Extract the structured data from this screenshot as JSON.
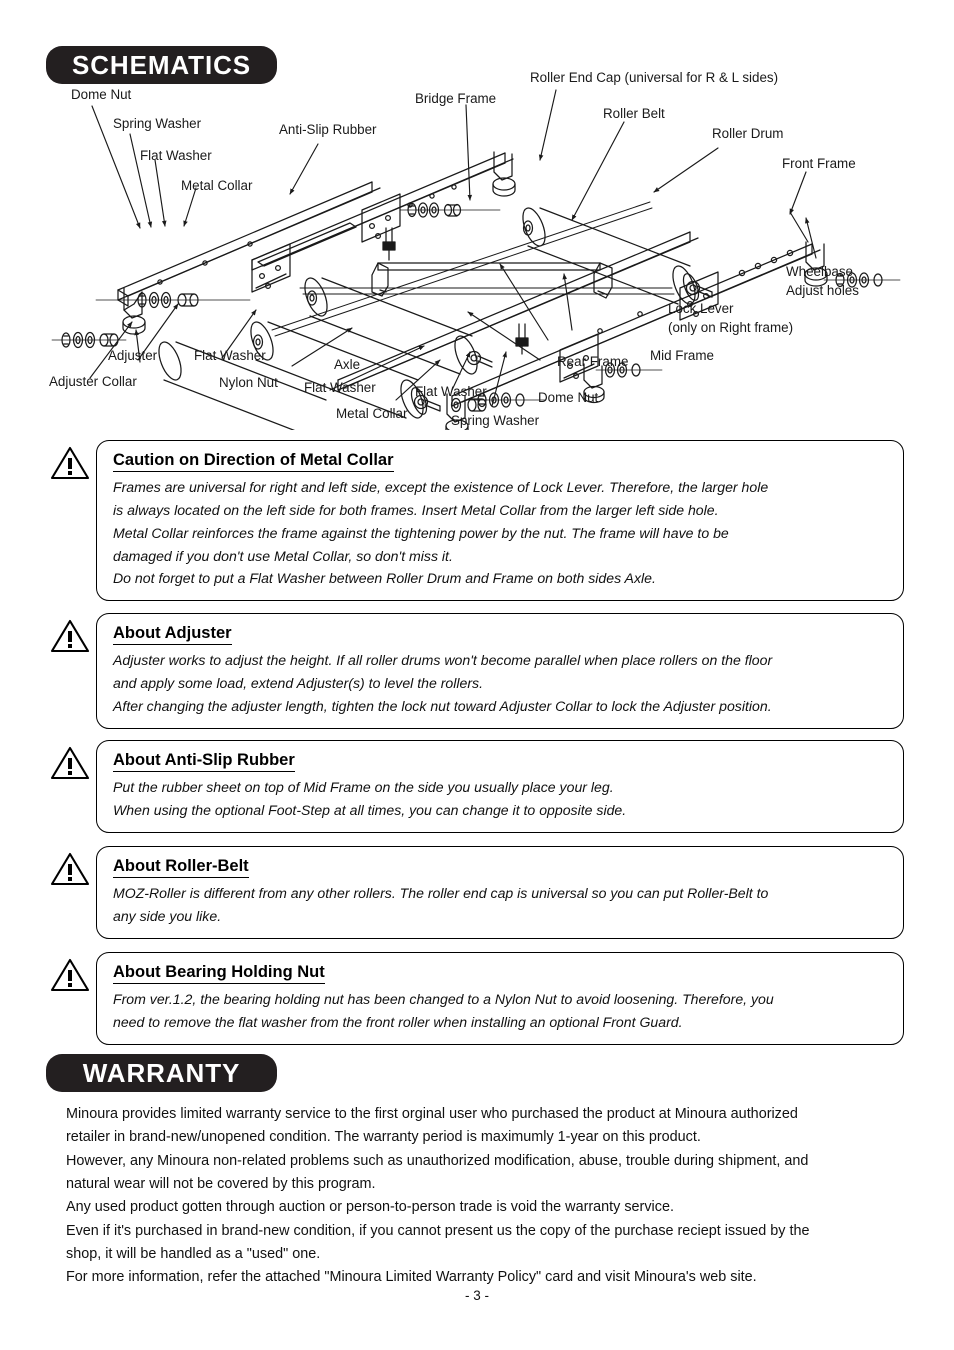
{
  "sections": {
    "schematics": {
      "badge_label": "SCHEMATICS"
    },
    "warranty": {
      "badge_label": "WARRANTY"
    }
  },
  "schematic": {
    "labels": [
      {
        "id": "dome-nut-left",
        "text": "Dome Nut"
      },
      {
        "id": "spring-washer-left",
        "text": "Spring Washer"
      },
      {
        "id": "flat-washer-upper-left",
        "text": "Flat Washer"
      },
      {
        "id": "metal-collar-upper-left",
        "text": "Metal Collar"
      },
      {
        "id": "anti-slip-rubber",
        "text": "Anti-Slip Rubber"
      },
      {
        "id": "bridge-frame",
        "text": "Bridge Frame"
      },
      {
        "id": "roller-end-cap",
        "text": "Roller End Cap (universal for R & L sides)"
      },
      {
        "id": "roller-belt",
        "text": "Roller Belt"
      },
      {
        "id": "roller-drum",
        "text": "Roller Drum"
      },
      {
        "id": "front-frame",
        "text": "Front Frame"
      },
      {
        "id": "wheelbase-line1",
        "text": "Wheelbase"
      },
      {
        "id": "wheelbase-line2",
        "text": "Adjust holes"
      },
      {
        "id": "lock-lever-line1",
        "text": "Lock Lever"
      },
      {
        "id": "lock-lever-line2",
        "text": "(only on Right frame)"
      },
      {
        "id": "mid-frame",
        "text": "Mid Frame"
      },
      {
        "id": "rear-frame",
        "text": "Rear Frame"
      },
      {
        "id": "dome-nut-right",
        "text": "Dome Nut"
      },
      {
        "id": "spring-washer-right",
        "text": "Spring Washer"
      },
      {
        "id": "flat-washer-right",
        "text": "Flat Washer"
      },
      {
        "id": "metal-collar-lower",
        "text": "Metal Collar"
      },
      {
        "id": "flat-washer-lower-mid",
        "text": "Flat Washer"
      },
      {
        "id": "axle",
        "text": "Axle"
      },
      {
        "id": "nylon-nut",
        "text": "Nylon Nut"
      },
      {
        "id": "flat-washer-lower-left",
        "text": "Flat Washer"
      },
      {
        "id": "adjuster",
        "text": "Adjuster"
      },
      {
        "id": "adjuster-collar",
        "text": "Adjuster Collar"
      }
    ]
  },
  "cautions": [
    {
      "id": "metal-collar",
      "title": "Caution on Direction of Metal Collar",
      "lines": [
        "Frames are universal for right and left side, except the existence of Lock Lever. Therefore, the larger hole",
        "is always located on the left side for both frames. Insert Metal Collar from the larger left side hole.",
        "Metal Collar reinforces the frame against the tightening power by the nut. The frame will have to be",
        "damaged if you don't use Metal Collar, so don't miss it.",
        "Do not forget to put a Flat Washer between Roller Drum and Frame on both sides Axle."
      ]
    },
    {
      "id": "adjuster",
      "title": "About Adjuster",
      "lines": [
        "Adjuster works to adjust the height. If all roller drums won't become parallel when place rollers on the floor",
        "and apply some load, extend Adjuster(s) to level the rollers.",
        "After changing the adjuster length, tighten the lock nut toward Adjuster Collar to lock the Adjuster position."
      ]
    },
    {
      "id": "anti-slip-rubber",
      "title": "About Anti-Slip Rubber",
      "lines": [
        "Put the rubber sheet on top of Mid Frame on the side you usually place your leg.",
        "When using the optional Foot-Step at all times, you can change it to opposite side."
      ]
    },
    {
      "id": "roller-belt",
      "title": "About Roller-Belt",
      "lines": [
        "MOZ-Roller is different from any other rollers. The roller end cap is universal so you can put Roller-Belt to",
        "any side you like."
      ]
    },
    {
      "id": "bearing-holding-nut",
      "title": "About Bearing Holding Nut",
      "lines": [
        "From ver.1.2, the bearing holding nut has been changed to a Nylon Nut to avoid loosening. Therefore, you",
        "need to remove the flat washer from the front roller when installing an optional Front Guard."
      ]
    }
  ],
  "warranty": {
    "lines": [
      "Minoura provides limited warranty service to the first orginal user who purchased the product at Minoura authorized",
      "retailer in brand-new/unopened condition. The warranty period is maximumly 1-year on this product.",
      "However, any Minoura non-related problems such as unauthorized modification, abuse, trouble during shipment, and",
      "natural wear will not be covered by this program.",
      "Any used product gotten through auction or person-to-person trade is void the warranty service.",
      "Even if it's purchased in brand-new condition, if you cannot present us the copy of the purchase reciept issued by the",
      "shop, it will be handled as a \"used\" one.",
      "For more information, refer the attached \"Minoura Limited Warranty Policy\" card and visit Minoura's web site."
    ]
  },
  "footer": {
    "page_number": "- 3 -"
  },
  "colors": {
    "badge_background": "#231f20",
    "badge_text": "#ffffff",
    "ink": "#1a1a1a"
  }
}
